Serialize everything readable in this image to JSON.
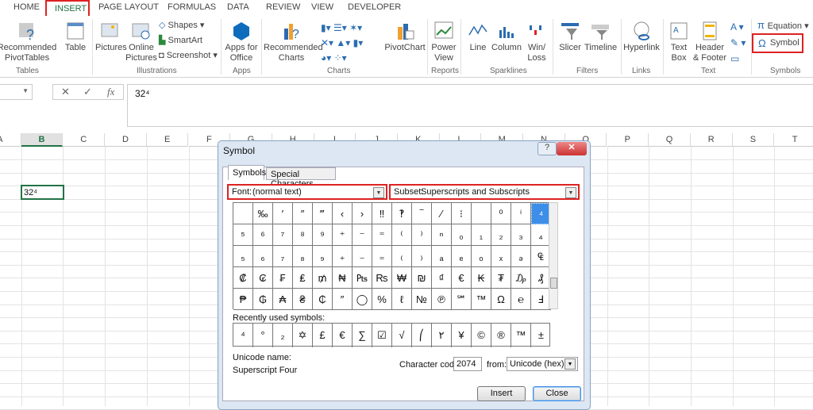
{
  "tabs": [
    "HOME",
    "INSERT",
    "PAGE LAYOUT",
    "FORMULAS",
    "DATA",
    "REVIEW",
    "VIEW",
    "DEVELOPER"
  ],
  "active_tab": "INSERT",
  "ribbon": {
    "tables": {
      "label": "Tables",
      "items": [
        "Recommended PivotTables",
        "Table"
      ]
    },
    "illustrations": {
      "label": "Illustrations",
      "items": [
        "Pictures",
        "Online Pictures",
        "Shapes",
        "SmartArt",
        "Screenshot"
      ]
    },
    "apps": {
      "label": "Apps",
      "items": [
        "Apps for Office"
      ]
    },
    "charts": {
      "label": "Charts",
      "items": [
        "Recommended Charts",
        "PivotChart"
      ]
    },
    "reports": {
      "label": "Reports",
      "items": [
        "Power View"
      ]
    },
    "sparklines": {
      "label": "Sparklines",
      "items": [
        "Line",
        "Column",
        "Win/ Loss"
      ]
    },
    "filters": {
      "label": "Filters",
      "items": [
        "Slicer",
        "Timeline"
      ]
    },
    "links": {
      "label": "Links",
      "items": [
        "Hyperlink"
      ]
    },
    "text": {
      "label": "Text",
      "items": [
        "Text Box",
        "Header & Footer"
      ]
    },
    "symbols": {
      "label": "Symbols",
      "items": [
        "Equation",
        "Symbol"
      ]
    }
  },
  "formula_bar": {
    "value": "32⁴",
    "fx": "fx"
  },
  "columns": [
    "A",
    "B",
    "C",
    "D",
    "E",
    "F",
    "G",
    "H",
    "I",
    "J",
    "K",
    "L",
    "M",
    "N",
    "O",
    "P",
    "Q",
    "R",
    "S",
    "T"
  ],
  "active_cell": {
    "value": "32⁴"
  },
  "dialog": {
    "title": "Symbol",
    "tabs": [
      "Symbols",
      "Special Characters"
    ],
    "font_label": "Font:",
    "font_value": "(normal text)",
    "subset_label": "Subset:",
    "subset_value": "Superscripts and Subscripts",
    "grid": [
      [
        "",
        "‰",
        "′",
        "″",
        "‴",
        "‹",
        "›",
        "‼",
        "‽",
        "‾",
        "⁄",
        "⁝",
        "",
        "⁰",
        "ⁱ",
        "⁴"
      ],
      [
        "⁵",
        "⁶",
        "⁷",
        "⁸",
        "⁹",
        "⁺",
        "⁻",
        "⁼",
        "⁽",
        "⁾",
        "ⁿ",
        "₀",
        "₁",
        "₂",
        "₃",
        "₄"
      ],
      [
        "₅",
        "₆",
        "₇",
        "₈",
        "₉",
        "₊",
        "₋",
        "₌",
        "₍",
        "₎",
        "ₐ",
        "ₑ",
        "ₒ",
        "ₓ",
        "ₔ",
        "₠"
      ],
      [
        "₡",
        "₢",
        "₣",
        "₤",
        "₥",
        "₦",
        "₧",
        "₨",
        "₩",
        "₪",
        "₫",
        "€",
        "₭",
        "₮",
        "₯",
        "₰"
      ],
      [
        "₱",
        "₲",
        "₳",
        "₴",
        "₵",
        "″",
        "◯",
        "%",
        "ℓ",
        "№",
        "℗",
        "℠",
        "™",
        "Ω",
        "℮",
        "Ⅎ"
      ]
    ],
    "selected_symbol": "⁴",
    "recent_label": "Recently used symbols:",
    "recent": [
      "⁴",
      "°",
      "₂",
      "✡",
      "£",
      "€",
      "∑",
      "☑",
      "√",
      "⎛",
      "٢",
      "¥",
      "©",
      "®",
      "™",
      "±"
    ],
    "unicode_name_label": "Unicode name:",
    "unicode_name": "Superscript Four",
    "char_code_label": "Character code:",
    "char_code": "2074",
    "from_label": "from:",
    "from_value": "Unicode (hex)",
    "insert": "Insert",
    "close": "Close",
    "accent": "#3d8ee8",
    "highlight": "#d22222"
  }
}
